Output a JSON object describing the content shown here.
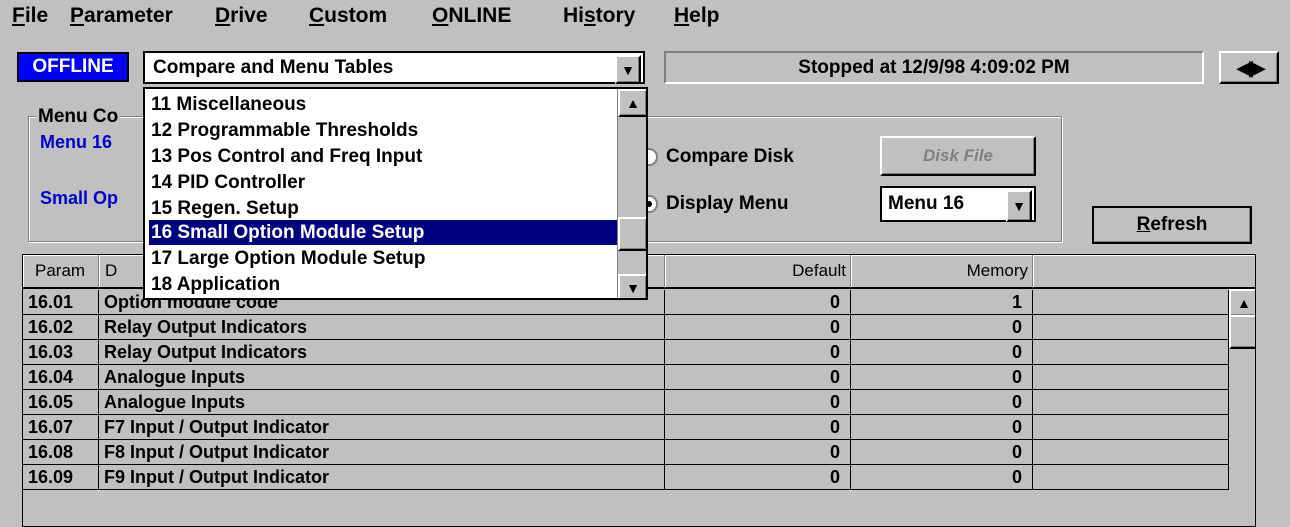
{
  "menubar": {
    "items": [
      {
        "mnemonic": "F",
        "rest": "ile"
      },
      {
        "mnemonic": "P",
        "rest": "arameter"
      },
      {
        "mnemonic": "D",
        "rest": "rive"
      },
      {
        "mnemonic": "C",
        "rest": "ustom"
      },
      {
        "mnemonic": "O",
        "rest": "NLINE"
      },
      {
        "pre": "Hi",
        "mnemonic": "s",
        "rest": "tory"
      },
      {
        "mnemonic": "H",
        "rest": "elp"
      }
    ]
  },
  "toolbar": {
    "mode_label": "OFFLINE",
    "table_select_value": "Compare and Menu Tables",
    "status_text": "Stopped at 12/9/98 4:09:02 PM"
  },
  "dropdown": {
    "items": [
      "11 Miscellaneous",
      "12 Programmable Thresholds",
      "13 Pos Control and Freq Input",
      "14 PID Controller",
      "15 Regen. Setup",
      "16 Small Option Module Setup",
      "17 Large Option Module Setup",
      "18 Application"
    ],
    "selected_index": 5
  },
  "menu_control": {
    "title": "Menu Co",
    "menu_label": "Menu 16",
    "small_label": "Small Op",
    "compare_disk_label": "Compare Disk",
    "display_menu_label": "Display Menu",
    "display_menu_selected": true,
    "disk_file_label": "Disk File",
    "menu_select_value": "Menu 16",
    "refresh_label": "Refresh",
    "refresh_mnemonic": "R",
    "refresh_rest": "efresh"
  },
  "grid": {
    "columns": [
      "Param",
      "D",
      "Default",
      "Memory",
      ""
    ],
    "rows": [
      {
        "param": "16.01",
        "desc": "Option module code",
        "default": "0",
        "memory": "1"
      },
      {
        "param": "16.02",
        "desc": "Relay Output Indicators",
        "default": "0",
        "memory": "0"
      },
      {
        "param": "16.03",
        "desc": "Relay Output Indicators",
        "default": "0",
        "memory": "0"
      },
      {
        "param": "16.04",
        "desc": "Analogue Inputs",
        "default": "0",
        "memory": "0"
      },
      {
        "param": "16.05",
        "desc": "Analogue Inputs",
        "default": "0",
        "memory": "0"
      },
      {
        "param": "16.07",
        "desc": "F7 Input / Output Indicator",
        "default": "0",
        "memory": "0"
      },
      {
        "param": "16.08",
        "desc": "F8 Input / Output Indicator",
        "default": "0",
        "memory": "0"
      },
      {
        "param": "16.09",
        "desc": "F9 Input / Output Indicator",
        "default": "0",
        "memory": "0"
      }
    ]
  },
  "icons": {
    "combo_arrow": "combo-dropdown-arrow-icon",
    "nav_arrows": "left-right-arrows-icon"
  },
  "colors": {
    "offline_bg": "#0000ff",
    "selection_bg": "#000080",
    "label_blue": "#0000cc",
    "face": "#c0c0c0"
  }
}
